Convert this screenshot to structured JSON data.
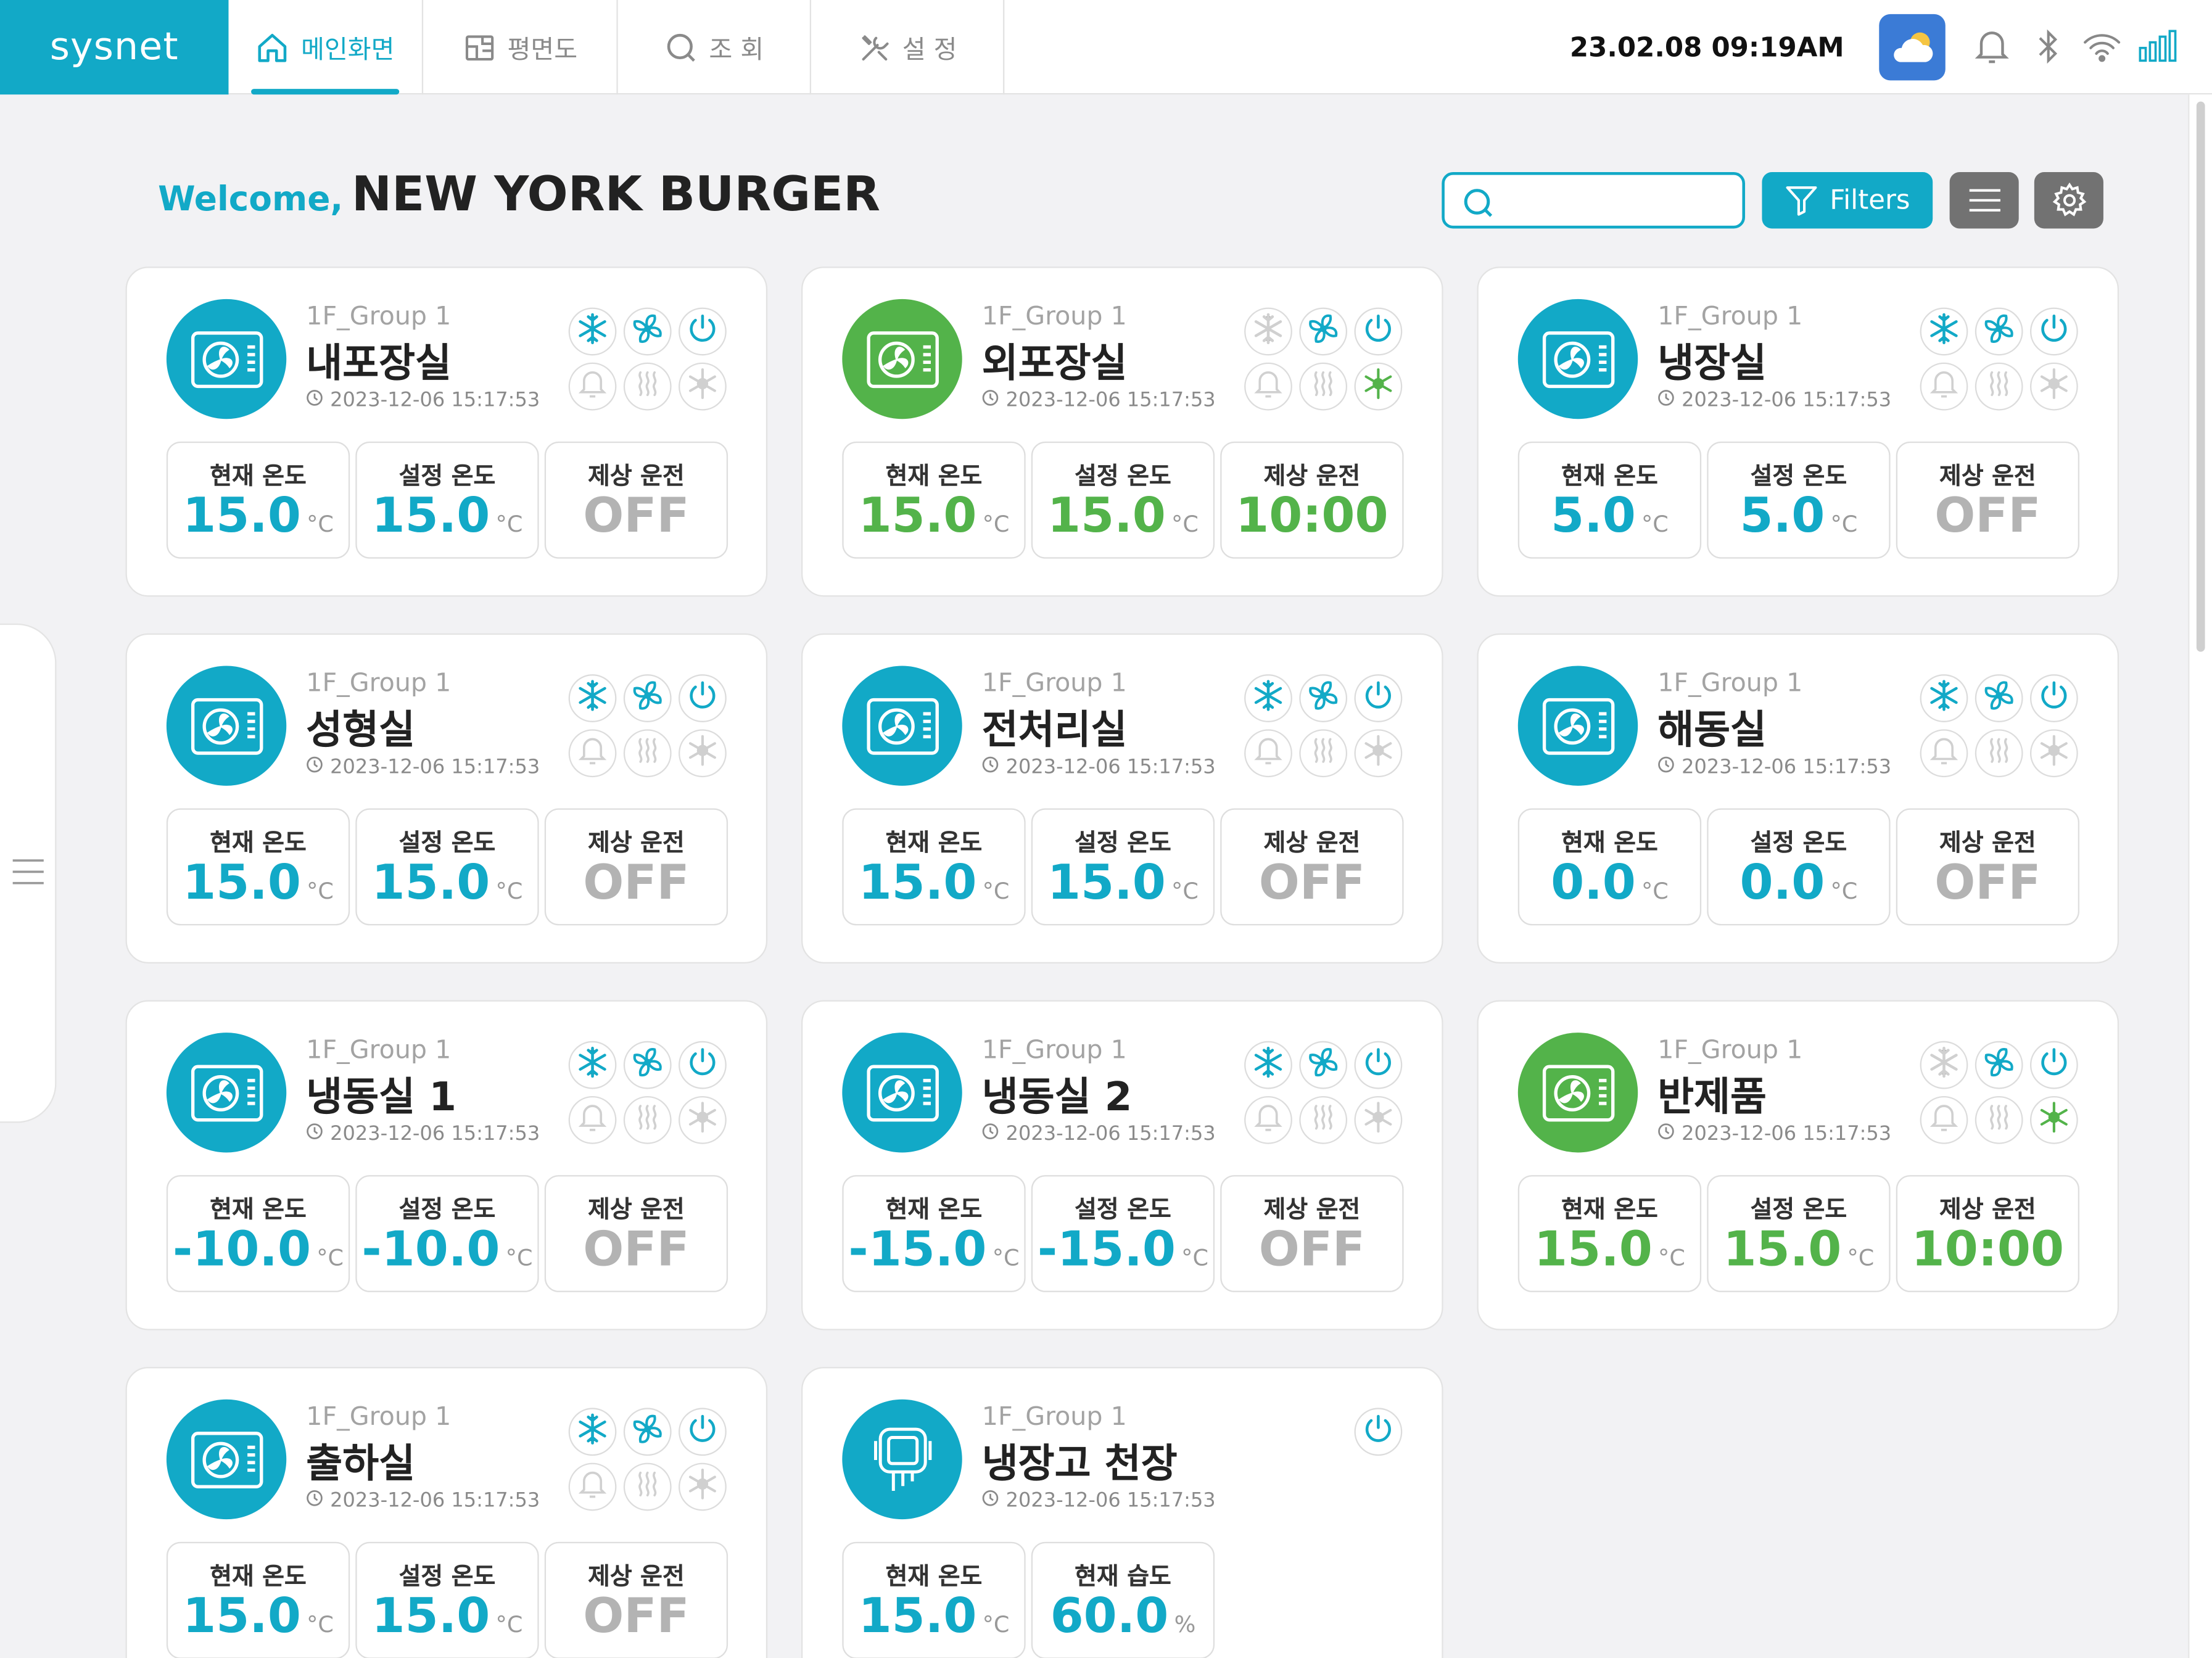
{
  "app": {
    "logo": "sysnet"
  },
  "nav": {
    "tabs": [
      {
        "label": "메인화면",
        "icon": "home-icon",
        "active": true
      },
      {
        "label": "평면도",
        "icon": "floorplan-icon",
        "active": false
      },
      {
        "label": "조 회",
        "icon": "search-icon",
        "active": false
      },
      {
        "label": "설 정",
        "icon": "settings-tools-icon",
        "active": false
      }
    ]
  },
  "status": {
    "datetime": "23.02.08  09:19AM",
    "weather_icon": "cloud-sun-icon"
  },
  "header": {
    "welcome": "Welcome,",
    "store": "NEW YORK BURGER"
  },
  "toolbar": {
    "filters_label": "Filters",
    "search_value": ""
  },
  "colors": {
    "accent": "#12a9c7",
    "green": "#53b34a",
    "off": "#b3b3b3"
  },
  "cards": [
    {
      "group": "1F_Group 1",
      "name": "내포장실",
      "time": "2023-12-06 15:17:53",
      "avatar": "blue",
      "type": "unit",
      "icons": {
        "snow": true,
        "fan": true,
        "power": true,
        "bell": false,
        "heat": false,
        "defrost": false
      },
      "stats": [
        {
          "label": "현재 온도",
          "value": "15.0",
          "unit": "°C",
          "color": "blue"
        },
        {
          "label": "설정 온도",
          "value": "15.0",
          "unit": "°C",
          "color": "blue"
        },
        {
          "label": "제상 운전",
          "value": "OFF",
          "unit": "",
          "color": "grey"
        }
      ]
    },
    {
      "group": "1F_Group 1",
      "name": "외포장실",
      "time": "2023-12-06 15:17:53",
      "avatar": "green",
      "type": "unit",
      "icons": {
        "snow": false,
        "fan": true,
        "power": true,
        "bell": false,
        "heat": false,
        "defrost": true
      },
      "stats": [
        {
          "label": "현재 온도",
          "value": "15.0",
          "unit": "°C",
          "color": "green"
        },
        {
          "label": "설정 온도",
          "value": "15.0",
          "unit": "°C",
          "color": "green"
        },
        {
          "label": "제상 운전",
          "value": "10:00",
          "unit": "",
          "color": "green"
        }
      ]
    },
    {
      "group": "1F_Group 1",
      "name": "냉장실",
      "time": "2023-12-06 15:17:53",
      "avatar": "blue",
      "type": "unit",
      "icons": {
        "snow": true,
        "fan": true,
        "power": true,
        "bell": false,
        "heat": false,
        "defrost": false
      },
      "stats": [
        {
          "label": "현재 온도",
          "value": "5.0",
          "unit": "°C",
          "color": "blue"
        },
        {
          "label": "설정 온도",
          "value": "5.0",
          "unit": "°C",
          "color": "blue"
        },
        {
          "label": "제상 운전",
          "value": "OFF",
          "unit": "",
          "color": "grey"
        }
      ]
    },
    {
      "group": "1F_Group 1",
      "name": "성형실",
      "time": "2023-12-06 15:17:53",
      "avatar": "blue",
      "type": "unit",
      "icons": {
        "snow": true,
        "fan": true,
        "power": true,
        "bell": false,
        "heat": false,
        "defrost": false
      },
      "stats": [
        {
          "label": "현재 온도",
          "value": "15.0",
          "unit": "°C",
          "color": "blue"
        },
        {
          "label": "설정 온도",
          "value": "15.0",
          "unit": "°C",
          "color": "blue"
        },
        {
          "label": "제상 운전",
          "value": "OFF",
          "unit": "",
          "color": "grey"
        }
      ]
    },
    {
      "group": "1F_Group 1",
      "name": "전처리실",
      "time": "2023-12-06 15:17:53",
      "avatar": "blue",
      "type": "unit",
      "icons": {
        "snow": true,
        "fan": true,
        "power": true,
        "bell": false,
        "heat": false,
        "defrost": false
      },
      "stats": [
        {
          "label": "현재 온도",
          "value": "15.0",
          "unit": "°C",
          "color": "blue"
        },
        {
          "label": "설정 온도",
          "value": "15.0",
          "unit": "°C",
          "color": "blue"
        },
        {
          "label": "제상 운전",
          "value": "OFF",
          "unit": "",
          "color": "grey"
        }
      ]
    },
    {
      "group": "1F_Group 1",
      "name": "해동실",
      "time": "2023-12-06 15:17:53",
      "avatar": "blue",
      "type": "unit",
      "icons": {
        "snow": true,
        "fan": true,
        "power": true,
        "bell": false,
        "heat": false,
        "defrost": false
      },
      "stats": [
        {
          "label": "현재 온도",
          "value": "0.0",
          "unit": "°C",
          "color": "blue"
        },
        {
          "label": "설정 온도",
          "value": "0.0",
          "unit": "°C",
          "color": "blue"
        },
        {
          "label": "제상 운전",
          "value": "OFF",
          "unit": "",
          "color": "grey"
        }
      ]
    },
    {
      "group": "1F_Group 1",
      "name": "냉동실 1",
      "time": "2023-12-06 15:17:53",
      "avatar": "blue",
      "type": "unit",
      "icons": {
        "snow": true,
        "fan": true,
        "power": true,
        "bell": false,
        "heat": false,
        "defrost": false
      },
      "stats": [
        {
          "label": "현재 온도",
          "value": "-10.0",
          "unit": "°C",
          "color": "blue"
        },
        {
          "label": "설정 온도",
          "value": "-10.0",
          "unit": "°C",
          "color": "blue"
        },
        {
          "label": "제상 운전",
          "value": "OFF",
          "unit": "",
          "color": "grey"
        }
      ]
    },
    {
      "group": "1F_Group 1",
      "name": "냉동실 2",
      "time": "2023-12-06 15:17:53",
      "avatar": "blue",
      "type": "unit",
      "icons": {
        "snow": true,
        "fan": true,
        "power": true,
        "bell": false,
        "heat": false,
        "defrost": false
      },
      "stats": [
        {
          "label": "현재 온도",
          "value": "-15.0",
          "unit": "°C",
          "color": "blue"
        },
        {
          "label": "설정 온도",
          "value": "-15.0",
          "unit": "°C",
          "color": "blue"
        },
        {
          "label": "제상 운전",
          "value": "OFF",
          "unit": "",
          "color": "grey"
        }
      ]
    },
    {
      "group": "1F_Group 1",
      "name": "반제품",
      "time": "2023-12-06 15:17:53",
      "avatar": "green",
      "type": "unit",
      "icons": {
        "snow": false,
        "fan": true,
        "power": true,
        "bell": false,
        "heat": false,
        "defrost": true
      },
      "stats": [
        {
          "label": "현재 온도",
          "value": "15.0",
          "unit": "°C",
          "color": "green"
        },
        {
          "label": "설정 온도",
          "value": "15.0",
          "unit": "°C",
          "color": "green"
        },
        {
          "label": "제상 운전",
          "value": "10:00",
          "unit": "",
          "color": "green"
        }
      ]
    },
    {
      "group": "1F_Group 1",
      "name": "출하실",
      "time": "2023-12-06 15:17:53",
      "avatar": "blue",
      "type": "unit",
      "icons": {
        "snow": true,
        "fan": true,
        "power": true,
        "bell": false,
        "heat": false,
        "defrost": false
      },
      "stats": [
        {
          "label": "현재 온도",
          "value": "15.0",
          "unit": "°C",
          "color": "blue"
        },
        {
          "label": "설정 온도",
          "value": "15.0",
          "unit": "°C",
          "color": "blue"
        },
        {
          "label": "제상 운전",
          "value": "OFF",
          "unit": "",
          "color": "grey"
        }
      ]
    },
    {
      "group": "1F_Group 1",
      "name": "냉장고 천장",
      "time": "2023-12-06 15:17:53",
      "avatar": "blue",
      "type": "sensor",
      "icons": {
        "power": true
      },
      "stats": [
        {
          "label": "현재 온도",
          "value": "15.0",
          "unit": "°C",
          "color": "blue"
        },
        {
          "label": "현재 습도",
          "value": "60.0",
          "unit": "%",
          "color": "blue"
        }
      ]
    }
  ]
}
